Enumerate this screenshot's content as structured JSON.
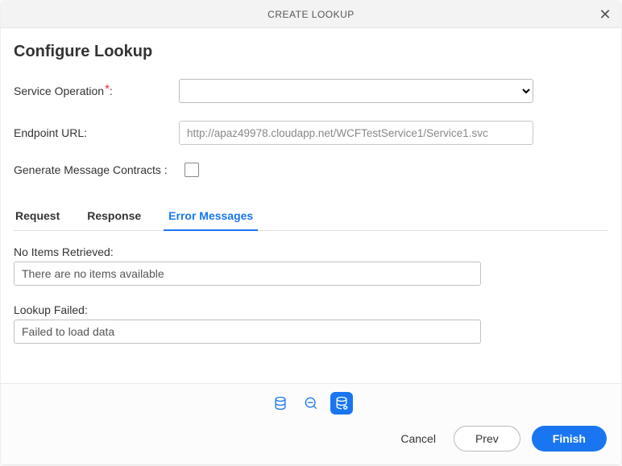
{
  "titlebar": {
    "title": "CREATE LOOKUP"
  },
  "page": {
    "title": "Configure Lookup"
  },
  "form": {
    "service_operation": {
      "label": "Service Operation",
      "value": ""
    },
    "endpoint_url": {
      "label": "Endpoint URL:",
      "value": "http://apaz49978.cloudapp.net/WCFTestService1/Service1.svc"
    },
    "generate_contracts": {
      "label": "Generate Message Contracts :",
      "checked": false
    }
  },
  "tabs": {
    "request": "Request",
    "response": "Response",
    "error_messages": "Error Messages",
    "active": "error_messages"
  },
  "errors": {
    "no_items": {
      "label": "No Items Retrieved:",
      "value": "There are no items available"
    },
    "lookup_failed": {
      "label": "Lookup Failed:",
      "value": "Failed to load data"
    }
  },
  "footer": {
    "cancel": "Cancel",
    "prev": "Prev",
    "finish": "Finish"
  }
}
